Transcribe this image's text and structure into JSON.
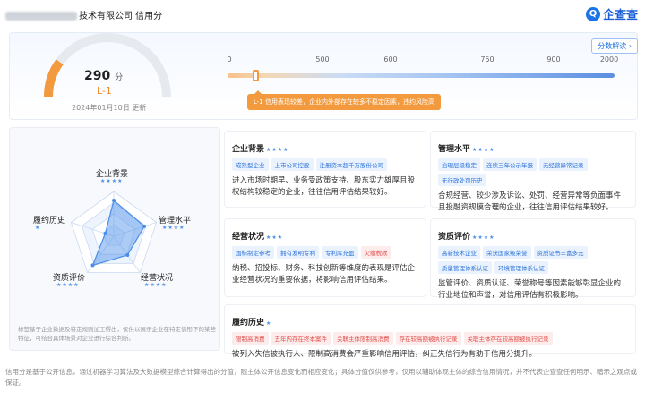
{
  "header": {
    "title": "技术有限公司 信用分",
    "logo_text": "企查查",
    "logo_mark": "Q"
  },
  "score": {
    "value": "290",
    "unit": "分",
    "level": "L-1",
    "update_text": "2024年01月10日 更新",
    "analyze_button": "分数解读",
    "gauge_fraction": 0.2
  },
  "scale": {
    "ticks": [
      "0",
      "500",
      "600",
      "750",
      "900",
      "2000"
    ],
    "tooltip": "L-1 信用表现较差，企业内外部存在较多不稳定因素，违约风险高"
  },
  "radar": {
    "axes": [
      {
        "label": "企业背景",
        "stars": "★★★★"
      },
      {
        "label": "管理水平",
        "stars": "★★★★"
      },
      {
        "label": "经营状况",
        "stars": "★★★★"
      },
      {
        "label": "资质评价",
        "stars": "★★★★"
      },
      {
        "label": "履约历史",
        "stars": "★"
      }
    ],
    "values": [
      4,
      3.6,
      2.6,
      4,
      1
    ],
    "note": "标签基于企业数据及特定规则加工得出，仅供以展示企业在特定情形下的某些特征，可结合具体场景对企业进行综合判断。"
  },
  "cards": {
    "background": {
      "title": "企业背景",
      "stars": "★★★★",
      "tags": [
        "成熟型企业",
        "上市公司控股",
        "注册资本超千万股份公司"
      ],
      "desc": "进入市场时期早、业务受政策支持、股东实力雄厚且股权结构较稳定的企业，往往信用评估结果较好。"
    },
    "management": {
      "title": "管理水平",
      "stars": "★★★★",
      "tags": [
        "治理层级稳定",
        "连续三年公示年报",
        "无经营异常记录",
        "无行政处罚历史"
      ],
      "desc": "合规经营、较少涉及诉讼、处罚、经营异常等负面事件且投融资规模合理的企业，往往信用评估结果较好。"
    },
    "operation": {
      "title": "经营状况",
      "stars": "★★★",
      "tags": [
        "国标制定参考",
        "拥有发明专利",
        "专利库充盈",
        "欠缴税款"
      ],
      "red_tags": [
        3
      ],
      "desc": "纳税、招投标、财务、科技创新等维度的表现是评估企业经营状况的重要依据，将影响信用评估结果。"
    },
    "qualification": {
      "title": "资质评价",
      "stars": "★★★★",
      "tags": [
        "高新技术企业",
        "荣获国家级荣誉",
        "资质证书丰富多元",
        "质量管理体系认证",
        "环境管理体系认证"
      ],
      "desc": "监管评价、资质认证、荣誉称号等因素能够彰显企业的行业地位和声誉，对信用评估有积极影响。"
    },
    "history": {
      "title": "履约历史",
      "stars": "★",
      "tags": [
        "限制高消费",
        "五年内存在终本案件",
        "关联主体限制高消费",
        "存在较高额被执行记录",
        "关联主体存在较高额被执行记录"
      ],
      "desc": "被列入失信被执行人、限制高消费会严重影响信用评估，纠正失信行为有助于信用分提升。"
    }
  },
  "footer": {
    "text": "信用分是基于公开信息，通过机器学习算法及大数据模型综合计算得出的分值，随主体公开信息变化而相应变化；具体分值仅供参考，仅用以辅助体现主体的综合信用情况，并不代表企查查任何明示、暗示之观点或保证。"
  },
  "colors": {
    "accent_orange": "#f29a3d",
    "accent_blue": "#2f74d8",
    "tag_red": "#e0504a"
  }
}
